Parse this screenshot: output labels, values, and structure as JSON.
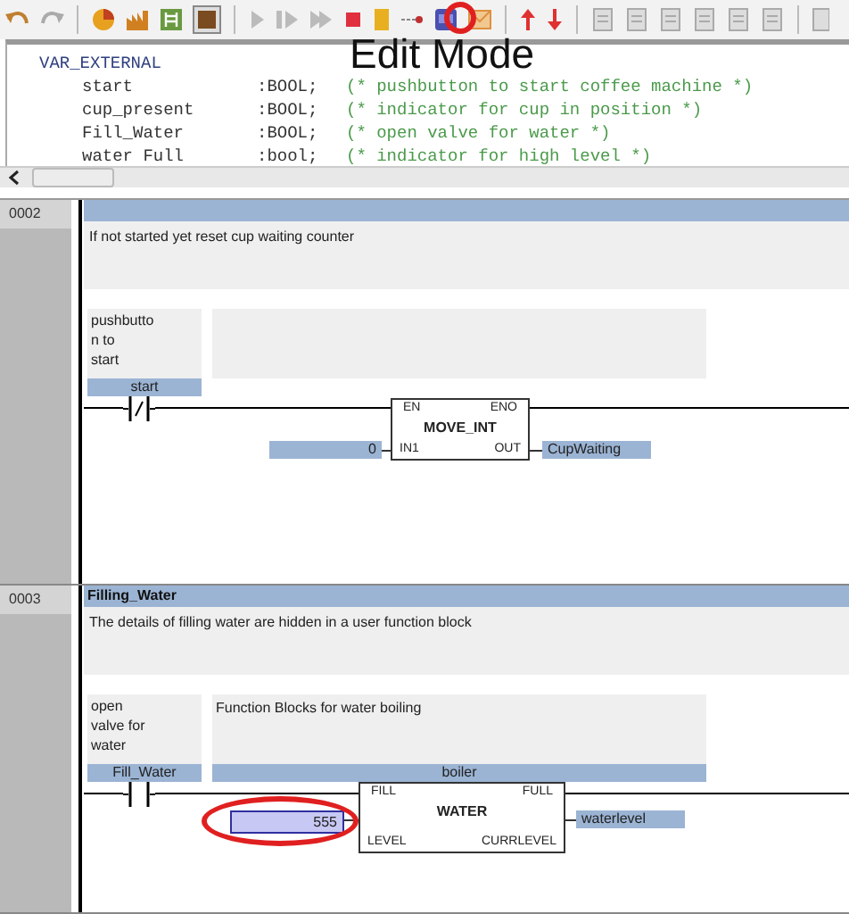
{
  "toolbar": {
    "callout": "Edit Mode"
  },
  "declarations": {
    "header": "VAR_EXTERNAL",
    "vars": [
      {
        "name": "start",
        "type": ":BOOL;",
        "comment": "(* pushbutton to start coffee machine *)"
      },
      {
        "name": "cup_present",
        "type": ":BOOL;",
        "comment": "(* indicator for cup in position *)"
      },
      {
        "name": "Fill_Water",
        "type": ":BOOL;",
        "comment": "(* open valve for water *)"
      },
      {
        "name": "water Full",
        "type": ":bool;",
        "comment": "(* indicator for high level *)"
      }
    ]
  },
  "networks": [
    {
      "number": "0002",
      "comment": "If not started yet reset cup waiting counter",
      "contact_comment": "pushbutto\nn to\nstart",
      "contact_var": "start",
      "negated": true,
      "block": {
        "name": "MOVE_INT",
        "pin_tl": "EN",
        "pin_tr": "ENO",
        "pin_bl": "IN1",
        "pin_br": "OUT"
      },
      "input": "0",
      "input_editing": false,
      "output": "CupWaiting"
    },
    {
      "number": "0003",
      "title": "Filling_Water",
      "comment": "The details of filling water are hidden in a user function block",
      "contact_comment": "open\nvalve for\nwater",
      "contact_var": "Fill_Water",
      "negated": false,
      "block_comment": "Function Blocks for water boiling",
      "instance": "boiler",
      "block": {
        "name": "WATER",
        "pin_tl": "FILL",
        "pin_tr": "FULL",
        "pin_bl": "LEVEL",
        "pin_br": "CURRLEVEL"
      },
      "input": "555",
      "input_editing": true,
      "output": "waterlevel"
    }
  ]
}
